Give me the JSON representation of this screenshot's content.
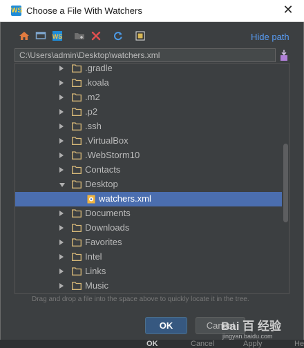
{
  "window": {
    "title": "Choose a File With Watchers",
    "close_glyph": "✕",
    "app_icon_label": "WS"
  },
  "toolbar": {
    "items": [
      {
        "name": "home-icon",
        "color": "#e27b3f"
      },
      {
        "name": "desktop-icon",
        "color": "#7fa7d0"
      },
      {
        "name": "webstorm-project-icon",
        "color": "#f5c242"
      },
      {
        "name": "new-folder-icon",
        "color": "#8a8a8a"
      },
      {
        "name": "delete-icon",
        "color": "#e35050"
      },
      {
        "name": "refresh-icon",
        "color": "#4c9be8"
      },
      {
        "name": "show-hidden-icon",
        "color": "#cfcfcf"
      }
    ],
    "hide_path_label": "Hide path"
  },
  "path_field": {
    "value": "C:\\Users\\admin\\Desktop\\watchers.xml"
  },
  "tree": {
    "items": [
      {
        "label": ".gradle",
        "type": "folder",
        "expanded": false,
        "level": 1
      },
      {
        "label": ".koala",
        "type": "folder",
        "expanded": false,
        "level": 1
      },
      {
        "label": ".m2",
        "type": "folder",
        "expanded": false,
        "level": 1
      },
      {
        "label": ".p2",
        "type": "folder",
        "expanded": false,
        "level": 1
      },
      {
        "label": ".ssh",
        "type": "folder",
        "expanded": false,
        "level": 1
      },
      {
        "label": ".VirtualBox",
        "type": "folder",
        "expanded": false,
        "level": 1
      },
      {
        "label": ".WebStorm10",
        "type": "folder",
        "expanded": false,
        "level": 1
      },
      {
        "label": "Contacts",
        "type": "folder",
        "expanded": false,
        "level": 1
      },
      {
        "label": "Desktop",
        "type": "folder",
        "expanded": true,
        "level": 1
      },
      {
        "label": "watchers.xml",
        "type": "file",
        "selected": true,
        "level": 2
      },
      {
        "label": "Documents",
        "type": "folder",
        "expanded": false,
        "level": 1
      },
      {
        "label": "Downloads",
        "type": "folder",
        "expanded": false,
        "level": 1
      },
      {
        "label": "Favorites",
        "type": "folder",
        "expanded": false,
        "level": 1
      },
      {
        "label": "Intel",
        "type": "folder",
        "expanded": false,
        "level": 1
      },
      {
        "label": "Links",
        "type": "folder",
        "expanded": false,
        "level": 1
      },
      {
        "label": "Music",
        "type": "folder",
        "expanded": false,
        "level": 1
      }
    ]
  },
  "hint": "Drag and drop a file into the space above to quickly locate it in the tree.",
  "buttons": {
    "ok_label": "OK",
    "cancel_label": "Cancel"
  },
  "background_buttons": {
    "ok_label": "OK",
    "cancel_label": "Cancel",
    "apply_label": "Apply",
    "help_label": "He"
  },
  "watermark": {
    "brand": "Bai 百 经验",
    "url": "jingyan.baidu.com"
  },
  "colors": {
    "dialog_bg": "#3c3f41",
    "selection": "#4b6eaf",
    "link": "#589df6",
    "folder": "#d8b979",
    "ok_button": "#365880"
  }
}
